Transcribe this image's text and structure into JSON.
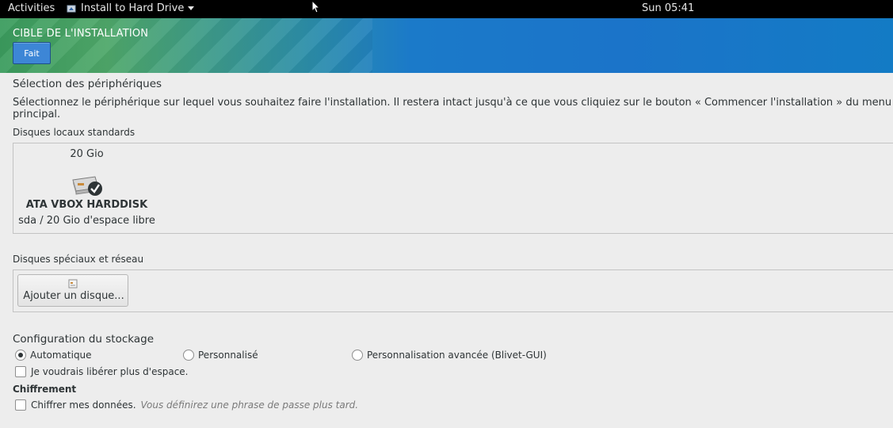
{
  "topbar": {
    "activities": "Activities",
    "app_name": "Install to Hard Drive",
    "clock": "Sun 05:41"
  },
  "header": {
    "title": "CIBLE DE L'INSTALLATION",
    "done_label": "Fait"
  },
  "device_selection": {
    "heading": "Sélection des périphériques",
    "description": "Sélectionnez le périphérique sur lequel vous souhaitez faire l'installation. Il restera intact jusqu'à ce que vous cliquiez sur le bouton « Commencer l'installation » du menu principal."
  },
  "local_disks": {
    "heading": "Disques locaux standards",
    "disks": [
      {
        "size": "20 Gio",
        "name": "ATA VBOX HARDDISK",
        "info": "sda  /  20 Gio d'espace libre",
        "selected": true,
        "icon": "harddisk-icon"
      }
    ]
  },
  "special_disks": {
    "heading": "Disques spéciaux et réseau",
    "add_disk_label": "Ajouter un disque..."
  },
  "storage_config": {
    "heading": "Configuration du stockage",
    "options": [
      {
        "label": "Automatique",
        "selected": true
      },
      {
        "label": "Personnalisé",
        "selected": false
      },
      {
        "label": "Personnalisation avancée (Blivet-GUI)",
        "selected": false
      }
    ],
    "free_space_label": "Je voudrais libérer plus d'espace."
  },
  "encryption": {
    "heading": "Chiffrement",
    "encrypt_label": "Chiffrer mes données.",
    "encrypt_hint": "Vous définirez une phrase de passe plus tard."
  },
  "colors": {
    "accent_button": "#3d86d6",
    "topbar": "#000000",
    "background": "#ededed"
  }
}
